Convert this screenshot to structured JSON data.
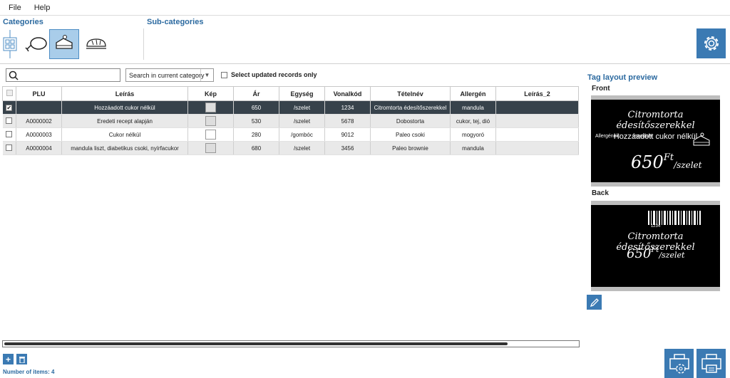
{
  "menu": {
    "file": "File",
    "help": "Help"
  },
  "categories_label": "Categories",
  "subcategories_label": "Sub-categories",
  "filter": {
    "search_value": "",
    "scope_option": "Search in current category",
    "updated_only_label": "Select updated records only"
  },
  "table": {
    "headers": [
      "PLU",
      "Leírás",
      "Kép",
      "Ár",
      "Egység",
      "Vonalkód",
      "Tételnév",
      "Allergén",
      "Leírás_2"
    ],
    "rows": [
      {
        "plu": "",
        "leiras": "Hozzáadott cukor nélkül",
        "ar": "650",
        "egyseg": "/szelet",
        "vonalkod": "1234",
        "tetelnev": "Citromtorta édesítőszerekkel",
        "allergen": "mandula",
        "leiras2": ""
      },
      {
        "plu": "A0000002",
        "leiras": "Eredeti recept alapján",
        "ar": "530",
        "egyseg": "/szelet",
        "vonalkod": "5678",
        "tetelnev": "Dobostorta",
        "allergen": "cukor, tej, dió",
        "leiras2": ""
      },
      {
        "plu": "A0000003",
        "leiras": "Cukor nélkül",
        "ar": "280",
        "egyseg": "/gombóc",
        "vonalkod": "9012",
        "tetelnev": "Paleo csoki",
        "allergen": "mogyoró",
        "leiras2": ""
      },
      {
        "plu": "A0000004",
        "leiras": "mandula liszt, diabetikus csoki, nyírfacukor",
        "ar": "680",
        "egyseg": "/szelet",
        "vonalkod": "3456",
        "tetelnev": "Paleo brownie",
        "allergen": "mandula",
        "leiras2": ""
      }
    ]
  },
  "footer": {
    "count_label": "Number of items:",
    "count_value": "4"
  },
  "preview": {
    "title": "Tag layout preview",
    "front_label": "Front",
    "back_label": "Back",
    "front": {
      "name": "Citromtorta édesítőszerekkel",
      "desc": "Hozzáadott cukor nélkül",
      "allergen_label": "Allergének:",
      "allergen_value": "mandula",
      "price": "650",
      "currency": "Ft",
      "unit": "/szelet"
    },
    "back": {
      "barcode_number": "1234",
      "name": "Citromtorta édesítőszerekkel",
      "price": "650",
      "currency": "Ft",
      "unit": "/szelet"
    }
  },
  "colors": {
    "accent": "#3b7ab3",
    "selected_row": "#37424b",
    "title_blue": "#2c6aa0"
  }
}
